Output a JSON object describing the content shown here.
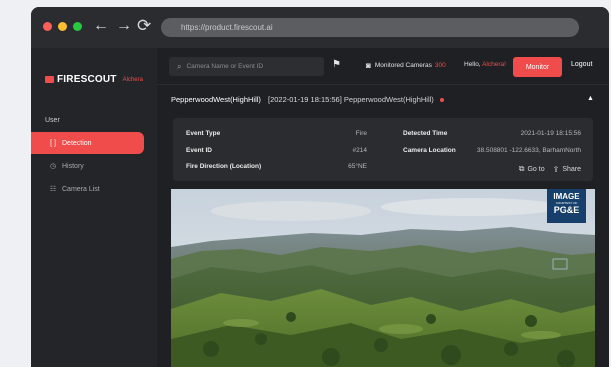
{
  "browser": {
    "url": "https://product.firescout.ai",
    "back_icon": "←",
    "forward_icon": "→",
    "reload_icon": "⟳"
  },
  "sidebar": {
    "brand": "FIRESCOUT",
    "brand_sub": "Alchera",
    "section": "User",
    "items": [
      {
        "label": "Detection",
        "icon": "[ ]",
        "active": true
      },
      {
        "label": "History",
        "icon": "◷",
        "active": false
      },
      {
        "label": "Camera List",
        "icon": "☷",
        "active": false
      }
    ]
  },
  "topbar": {
    "search_placeholder": "Camera Name or Event ID",
    "monitored_label": "Monitored Cameras",
    "monitored_count": "300",
    "hello_label": "Hello,",
    "user_name": "Alchera!",
    "monitor_button": "Monitor",
    "logout": "Logout"
  },
  "event": {
    "camera": "PepperwoodWest(HighHill)",
    "timestamp": "[2022-01-19 18:15:56]",
    "camera_repeat": "PepperwoodWest(HighHill)"
  },
  "details": {
    "event_type_label": "Event Type",
    "event_type_value": "Fire",
    "event_id_label": "Event ID",
    "event_id_value": "#214",
    "direction_label": "Fire Direction (Location)",
    "direction_value": "65°NE",
    "detected_time_label": "Detected Time",
    "detected_time_value": "2021-01-19 18:15:56",
    "location_label": "Camera Location",
    "location_value": "38.508801 -122.6633, BarhamNorth",
    "goto_label": "Go to",
    "share_label": "Share"
  },
  "image_badge": {
    "line1": "IMAGE",
    "line2": "COURTESY OF",
    "line3": "PG&E"
  },
  "colors": {
    "accent": "#f04c4c",
    "background": "#1f2023",
    "sidebar": "#242529",
    "panel": "#2b2c30",
    "badge": "#16406b"
  }
}
